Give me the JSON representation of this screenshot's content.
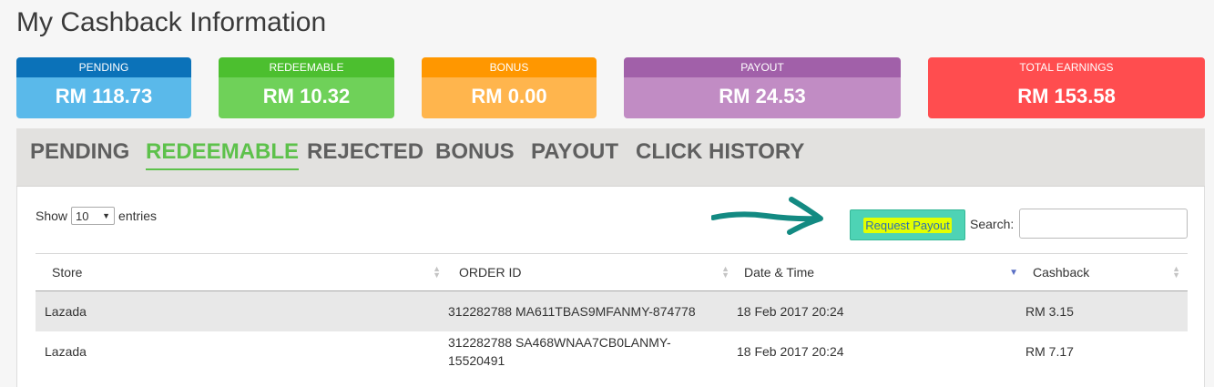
{
  "page": {
    "title": "My Cashback Information"
  },
  "cards": [
    {
      "label": "PENDING",
      "value": "RM 118.73",
      "head_color": "#0b72b9",
      "body_color": "#5ab9ea"
    },
    {
      "label": "REDEEMABLE",
      "value": "RM 10.32",
      "head_color": "#4cbf2f",
      "body_color": "#6fd159"
    },
    {
      "label": "BONUS",
      "value": "RM 0.00",
      "head_color": "#ff9700",
      "body_color": "#ffb54d"
    },
    {
      "label": "PAYOUT",
      "value": "RM 24.53",
      "head_color": "#a160a9",
      "body_color": "#c18cc4"
    },
    {
      "label": "TOTAL EARNINGS",
      "value": "RM 153.58",
      "head_color": "#ff4d4f",
      "body_color": "#ff4d4f"
    }
  ],
  "tabs": [
    {
      "label": "PENDING"
    },
    {
      "label": "REDEEMABLE",
      "active": true
    },
    {
      "label": "REJECTED"
    },
    {
      "label": "BONUS"
    },
    {
      "label": "PAYOUT"
    },
    {
      "label": "CLICK HISTORY"
    }
  ],
  "controls": {
    "show_label": "Show",
    "entries_value": "10",
    "entries_label": "entries",
    "request_payout_label": "Request Payout",
    "search_label": "Search:",
    "search_value": ""
  },
  "table": {
    "headers": [
      "Store",
      "ORDER ID",
      "Date & Time",
      "Cashback"
    ],
    "rows": [
      {
        "store": "Lazada",
        "order_id": "312282788 MA611TBAS9MFANMY-874778",
        "datetime": "18 Feb 2017 20:24",
        "cashback": "RM 3.15"
      },
      {
        "store": "Lazada",
        "order_id": "312282788 SA468WNAA7CB0LANMY-15520491",
        "datetime": "18 Feb 2017 20:24",
        "cashback": "RM 7.17"
      }
    ]
  },
  "icons": {
    "arrow": "right-arrow-icon",
    "sort": "sort-icon",
    "sort_desc": "sort-desc-icon",
    "caret": "chevron-down-icon"
  },
  "colors": {
    "tab_active": "#5dc14b",
    "payout_button": "#4ed3b5",
    "highlight": "#e3ff00",
    "arrow": "#138a82"
  }
}
